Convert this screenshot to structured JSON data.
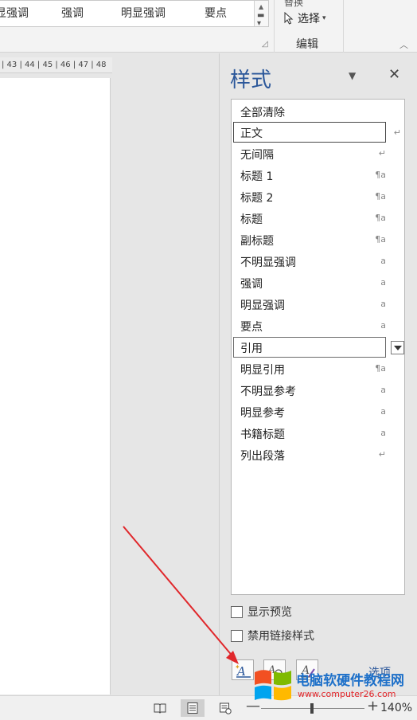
{
  "ribbon": {
    "gallery_items": [
      "显强调",
      "强调",
      "明显强调",
      "要点"
    ],
    "replace_label": "替换",
    "select_label": "选择",
    "editing_group_label": "编辑"
  },
  "ruler": {
    "text": "| 43 | 44 | 45 | 46 | 47 | 48"
  },
  "styles_pane": {
    "title": "样式",
    "items": [
      {
        "name": "全部清除",
        "mark": ""
      },
      {
        "name": "正文",
        "mark": "↵"
      },
      {
        "name": "无间隔",
        "mark": "↵"
      },
      {
        "name": "标题 1",
        "mark": "¶a"
      },
      {
        "name": "标题 2",
        "mark": "¶a"
      },
      {
        "name": "标题",
        "mark": "¶a"
      },
      {
        "name": "副标题",
        "mark": "¶a"
      },
      {
        "name": "不明显强调",
        "mark": "a"
      },
      {
        "name": "强调",
        "mark": "a"
      },
      {
        "name": "明显强调",
        "mark": "a"
      },
      {
        "name": "要点",
        "mark": "a"
      },
      {
        "name": "引用",
        "mark": ""
      },
      {
        "name": "明显引用",
        "mark": "¶a"
      },
      {
        "name": "不明显参考",
        "mark": "a"
      },
      {
        "name": "明显参考",
        "mark": "a"
      },
      {
        "name": "书籍标题",
        "mark": "a"
      },
      {
        "name": "列出段落",
        "mark": "↵"
      }
    ],
    "show_preview_label": "显示预览",
    "disable_linked_label": "禁用链接样式",
    "options_label": "选项..."
  },
  "status_bar": {
    "zoom_minus": "—",
    "zoom_plus": "+",
    "zoom_level": "140%"
  },
  "watermark": {
    "title": "电脑软硬件教程网",
    "url": "www.computer26.com"
  },
  "colors": {
    "accent": "#2b579a",
    "arrow": "#e0272b"
  }
}
